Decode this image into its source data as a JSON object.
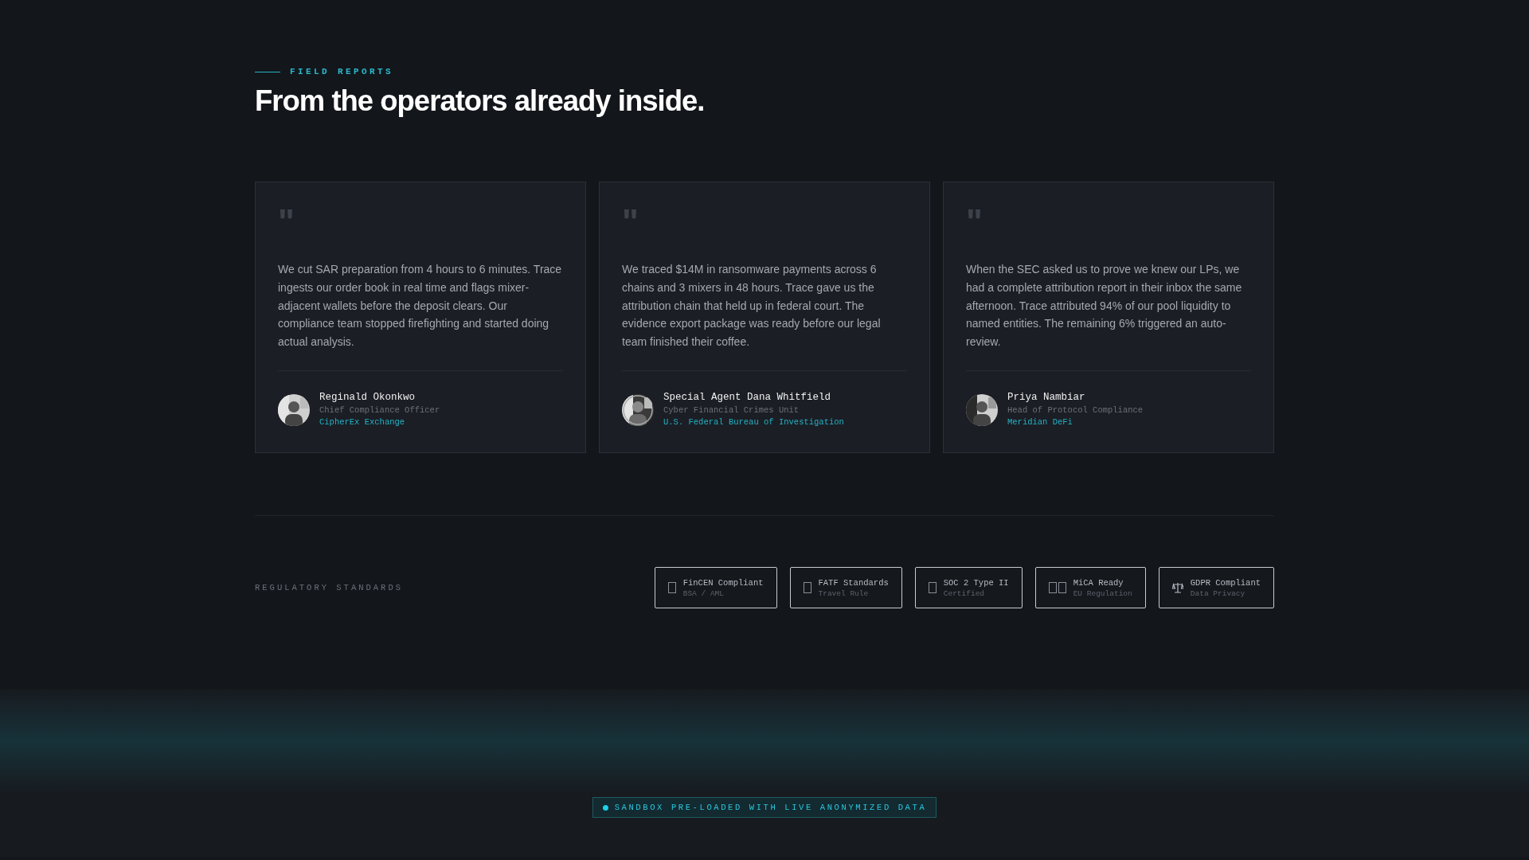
{
  "eyebrow": "FIELD REPORTS",
  "heading": "From the operators already inside.",
  "quote_mark": "\"",
  "testimonials": [
    {
      "quote": "We cut SAR preparation from 4 hours to 6 minutes. Trace ingests our order book in real time and flags mixer-adjacent wallets before the deposit clears. Our compliance team stopped firefighting and started doing actual analysis.",
      "name": "Reginald Okonkwo",
      "role": "Chief Compliance Officer",
      "org": "CipherEx Exchange"
    },
    {
      "quote": "We traced $14M in ransomware payments across 6 chains and 3 mixers in 48 hours. Trace gave us the attribution chain that held up in federal court. The evidence export package was ready before our legal team finished their coffee.",
      "name": "Special Agent Dana Whitfield",
      "role": "Cyber Financial Crimes Unit",
      "org": "U.S. Federal Bureau of Investigation"
    },
    {
      "quote": "When the SEC asked us to prove we knew our LPs, we had a complete attribution report in their inbox the same afternoon. Trace attributed 94% of our pool liquidity to named entities. The remaining 6% triggered an auto-review.",
      "name": "Priya Nambiar",
      "role": "Head of Protocol Compliance",
      "org": "Meridian DeFi"
    }
  ],
  "standards_label": "REGULATORY STANDARDS",
  "standards": [
    {
      "kind": "box",
      "title": "FinCEN Compliant",
      "subtitle": "BSA / AML"
    },
    {
      "kind": "box",
      "title": "FATF Standards",
      "subtitle": "Travel Rule"
    },
    {
      "kind": "box",
      "title": "SOC 2 Type II",
      "subtitle": "Certified"
    },
    {
      "kind": "double-box",
      "title": "MiCA Ready",
      "subtitle": "EU Regulation"
    },
    {
      "kind": "scale",
      "title": "GDPR Compliant",
      "subtitle": "Data Privacy"
    }
  ],
  "sandbox_badge": "SANDBOX PRE-LOADED WITH LIVE ANONYMIZED DATA"
}
